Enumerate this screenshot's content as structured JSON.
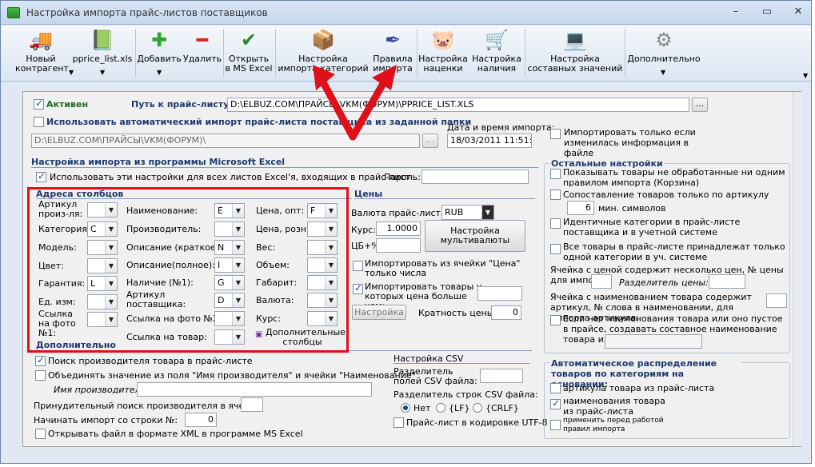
{
  "window": {
    "title": "Настройка импорта прайс-листов поставщиков",
    "controls": [
      "–",
      "▭",
      "✕"
    ]
  },
  "toolbar": [
    {
      "name": "tb-new-contractor",
      "label": "Новый контрагент",
      "icon": "truck-icon",
      "glyph": "🚚",
      "dropdown": true
    },
    {
      "name": "tb-pprice",
      "label": "pprice_list.xls",
      "icon": "excel-file-icon",
      "glyph": "📗",
      "dropdown": true
    },
    {
      "name": "tb-add",
      "label": "Добавить",
      "icon": "plus-icon",
      "glyph": "✚",
      "dropdown": true
    },
    {
      "name": "tb-delete",
      "label": "Удалить",
      "icon": "minus-icon",
      "glyph": "━",
      "dropdown": false
    },
    {
      "name": "tb-open-excel",
      "label": "Открыть в MS Excel",
      "icon": "checkmark-icon",
      "glyph": "✔",
      "dropdown": false
    },
    {
      "name": "tb-category-import",
      "label": "Настройка импорта категорий",
      "icon": "box-icon",
      "glyph": "📦",
      "dropdown": false
    },
    {
      "name": "tb-import-rules",
      "label": "Правила импорта",
      "icon": "quill-icon",
      "glyph": "✒",
      "dropdown": false
    },
    {
      "name": "tb-markup",
      "label": "Настройка наценки",
      "icon": "piggy-bank-icon",
      "glyph": "🐷",
      "dropdown": false
    },
    {
      "name": "tb-stock",
      "label": "Настройка наличия",
      "icon": "cart-icon",
      "glyph": "🛒",
      "dropdown": false
    },
    {
      "name": "tb-composite",
      "label": "Настройка составных значений",
      "icon": "laptop-icon",
      "glyph": "💻",
      "dropdown": false
    },
    {
      "name": "tb-more",
      "label": "Дополнительно",
      "icon": "gear-icon",
      "glyph": "⚙",
      "dropdown": true
    }
  ],
  "top": {
    "active_label": "Активен",
    "path_label": "Путь к прайс-листу:",
    "path_value": "D:\\ELBUZ.COM\\ПРАЙСЫ\\VKM(ФОРУМ)\\PPRICE_LIST.XLS",
    "browse": "...",
    "auto_import_label": "Использовать автоматический импорт прайс-листа поставщика из заданной папки",
    "folder_value": "D:\\ELBUZ.COM\\ПРАЙСЫ\\VKM(ФОРУМ)\\",
    "datetime_label": "Дата и время импорта:",
    "datetime_value": "18/03/2011 11:51:12",
    "only_if_changed": "Импортировать только если изменилась информация в файле"
  },
  "excel": {
    "title": "Настройка импорта из программы Microsoft Excel",
    "use_for_all": "Использовать эти настройки для всех листов Excel'я, входящих в прайс-лист",
    "password_label": "Пароль:",
    "password_value": "",
    "columns_title": "Адреса столбцов",
    "col1": [
      {
        "label": "Артикул произ-ля:",
        "value": ""
      },
      {
        "label": "Категория:",
        "value": "C"
      },
      {
        "label": "Модель:",
        "value": ""
      },
      {
        "label": "Цвет:",
        "value": ""
      },
      {
        "label": "Гарантия:",
        "value": "L"
      },
      {
        "label": "Ед. изм:",
        "value": ""
      },
      {
        "label": "Ссылка на фото №1:",
        "value": ""
      }
    ],
    "col2": [
      {
        "label": "Наименование:",
        "value": "E"
      },
      {
        "label": "Производитель:",
        "value": ""
      },
      {
        "label": "Описание (краткое):",
        "value": "N"
      },
      {
        "label": "Описание(полное):",
        "value": "I"
      },
      {
        "label": "Наличие (№1):",
        "value": "G"
      },
      {
        "label": "Артикул поставщика:",
        "value": "D"
      },
      {
        "label": "Ссылка на фото №2:",
        "value": ""
      },
      {
        "label": "Ссылка на товар:",
        "value": ""
      }
    ],
    "col3": [
      {
        "label": "Цена, опт:",
        "value": "F"
      },
      {
        "label": "Цена, розн.:",
        "value": ""
      },
      {
        "label": "Вес:",
        "value": ""
      },
      {
        "label": "Объем:",
        "value": ""
      },
      {
        "label": "Габарит:",
        "value": ""
      },
      {
        "label": "Валюта:",
        "value": ""
      },
      {
        "label": "Курс:",
        "value": ""
      }
    ],
    "extra_columns": "Дополнительные столбцы",
    "prices_title": "Цены",
    "currency_label": "Валюта прайс-листа:",
    "currency_value": "RUB",
    "rate_label": "Курс:",
    "rate_value": "1.0000",
    "cb_label": "ЦБ+%",
    "multicurrency": "Настройка мультивалюты",
    "import_from_price": "Импортировать из ячейки \"Цена\" только числа",
    "import_greater": "Импортировать товары у которых цена больше чем:",
    "settings_btn": "Настройка",
    "multiplicity_label": "Кратность цены:",
    "multiplicity_value": "0"
  },
  "additional": {
    "title": "Дополнительно",
    "search_manufacturer": "Поиск производителя товара в прайс-листе",
    "merge_value": "Объединять значение из поля \"Имя производителя\" и ячейки \"Наименование\"",
    "manufacturer_name_label": "Имя производителя:",
    "forced_search": "Принудительный поиск производителя в ячейке:",
    "start_row_label": "Начинать импорт со строки №:",
    "start_row_value": "0",
    "open_xml": "Открывать файл в формате XML в программе MS Excel"
  },
  "csv": {
    "title": "Настройка CSV",
    "field_sep": "Разделитель полей CSV файла:",
    "row_sep": "Разделитель строк CSV файла:",
    "options": [
      "Нет",
      "{LF}",
      "{CRLF}"
    ],
    "utf8": "Прайс-лист в кодировке UTF-8"
  },
  "other": {
    "title": "Остальные настройки",
    "show_unprocessed": "Показывать товары не обработанные ни одним правилом импорта (Корзина)",
    "match_by_article": "Сопоставление товаров только по артикулу",
    "min_symbols_value": "6",
    "min_symbols_label": "мин. символов",
    "identical_categories": "Идентичные категории в прайс-листе поставщика и в учетной системе",
    "one_category": "Все товары в прайс-листе принадлежат только одной категории в уч. системе",
    "price_cell_label": "Ячейка с ценой содержит несколько цен, № цены для импорта:",
    "price_sep_label": "Разделитель цены:",
    "word_number_label": "Ячейка с наименованием товара содержит артикул, № слова в наименовании, для импорта артикула:",
    "composite_name": "Если нет наименования товара или оно пустое в прайсе, создавать составное наименование товара из ячеек:"
  },
  "auto": {
    "title": "Автоматическое распределение товаров по категориям на основании:",
    "by_article": "артикула товара из прайс-листа",
    "by_name": "наименования товара из прайс-листа",
    "apply_before": "применить перед работой правил импорта"
  }
}
